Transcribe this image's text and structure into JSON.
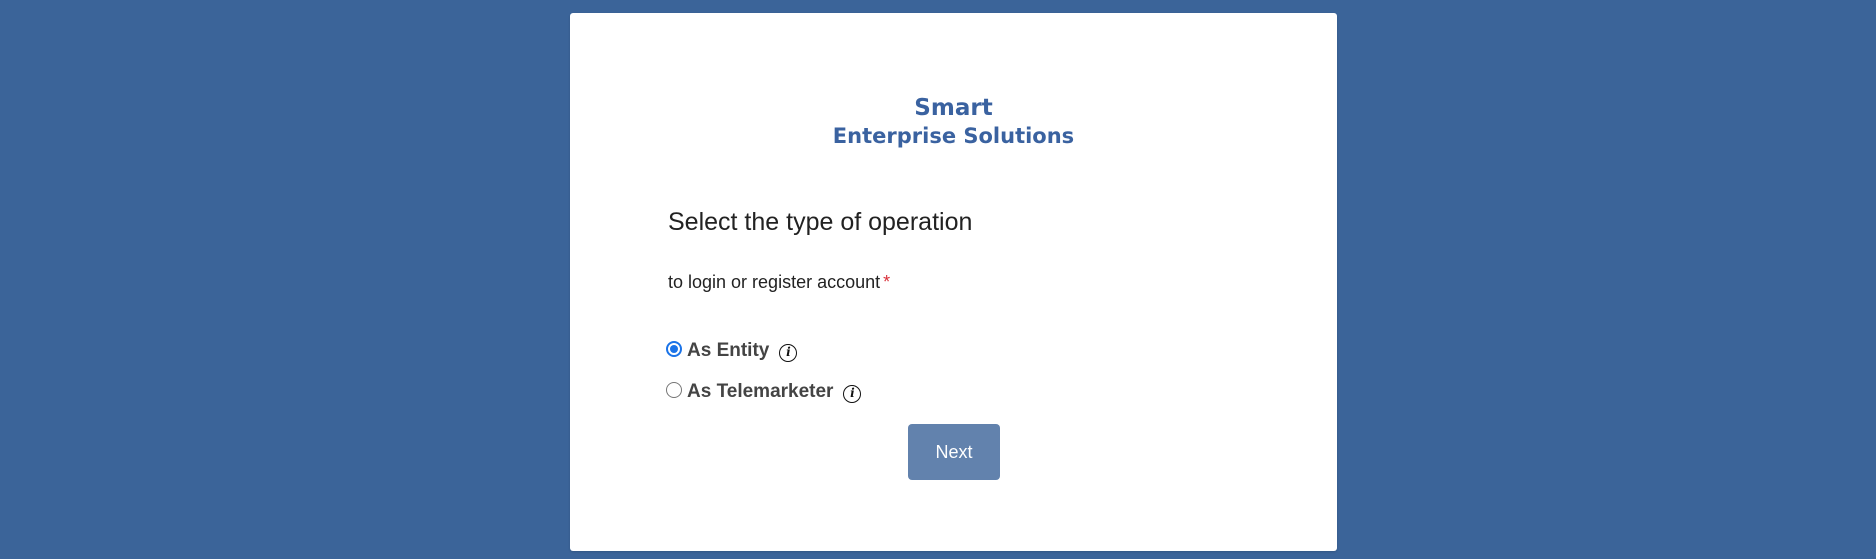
{
  "logo": {
    "line1": "Smart",
    "line2": "Enterprise Solutions"
  },
  "form": {
    "title": "Select the type of operation",
    "subtitle": "to login or register account",
    "required_marker": "*",
    "options": [
      {
        "label": "As Entity",
        "checked": true,
        "info_icon": "info-icon"
      },
      {
        "label": "As Telemarketer",
        "checked": false,
        "info_icon": "info-icon"
      }
    ],
    "next_label": "Next"
  },
  "colors": {
    "background": "#3b6499",
    "brand": "#3a62a0",
    "button": "#6282ad",
    "required": "#d9303a",
    "radio_checked": "#1a73e8"
  }
}
